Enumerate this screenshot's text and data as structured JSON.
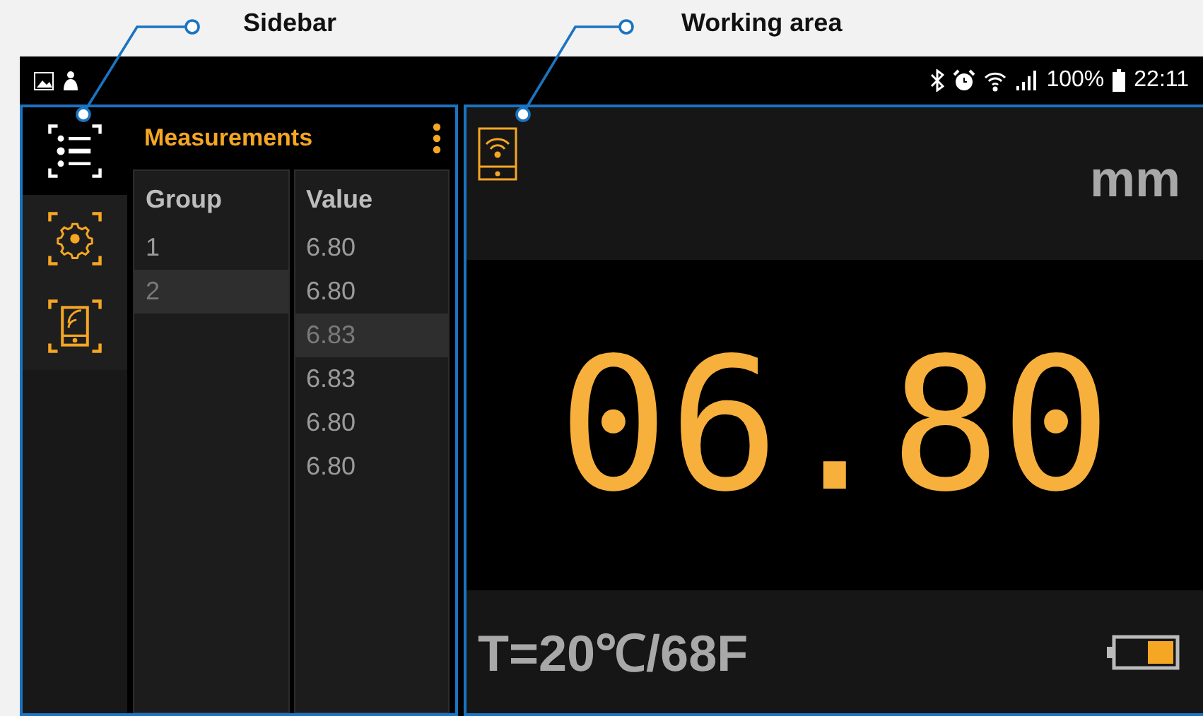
{
  "callouts": [
    {
      "label": "Sidebar"
    },
    {
      "label": "Working area"
    }
  ],
  "status_bar": {
    "battery_text": "100%",
    "time": "22:11"
  },
  "sidebar": {
    "items": [
      {
        "kind": "list",
        "selected": true
      },
      {
        "kind": "settings",
        "selected": false
      },
      {
        "kind": "device",
        "selected": false
      }
    ]
  },
  "measurements": {
    "title": "Measurements",
    "columns": [
      {
        "header": "Group",
        "rows": [
          {
            "text": "1",
            "selected": false
          },
          {
            "text": "2",
            "selected": true
          }
        ]
      },
      {
        "header": "Value",
        "rows": [
          {
            "text": "6.80",
            "selected": false
          },
          {
            "text": "6.80",
            "selected": false
          },
          {
            "text": "6.83",
            "selected": true
          },
          {
            "text": "6.83",
            "selected": false
          },
          {
            "text": "6.80",
            "selected": false
          },
          {
            "text": "6.80",
            "selected": false
          }
        ]
      }
    ]
  },
  "working_area": {
    "unit": "mm",
    "reading": "06.80",
    "temperature": "T=20℃/68F"
  }
}
